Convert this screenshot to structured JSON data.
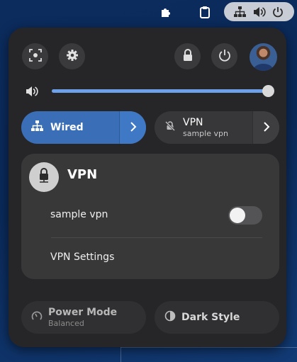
{
  "topbar": {
    "icons": [
      "extension-icon",
      "clipboard-icon",
      "network-wired-icon",
      "volume-icon",
      "power-icon"
    ]
  },
  "panel": {
    "header_buttons": [
      "screenshot-icon",
      "settings-icon",
      "lock-icon",
      "power-icon"
    ],
    "volume": {
      "level": 1.0
    },
    "toggles": {
      "wired": {
        "label": "Wired",
        "active": true
      },
      "vpn": {
        "label": "VPN",
        "subtitle": "sample vpn",
        "active": false
      }
    },
    "vpn_menu": {
      "title": "VPN",
      "items": [
        {
          "label": "sample vpn",
          "enabled": false
        }
      ],
      "settings_label": "VPN Settings"
    },
    "bottom": {
      "power_mode": {
        "label": "Power Mode",
        "subtitle": "Balanced"
      },
      "dark_style": {
        "label": "Dark Style"
      }
    }
  },
  "colors": {
    "accent": "#3a6fb7",
    "panel_bg": "#262628",
    "menu_bg": "#383839"
  }
}
